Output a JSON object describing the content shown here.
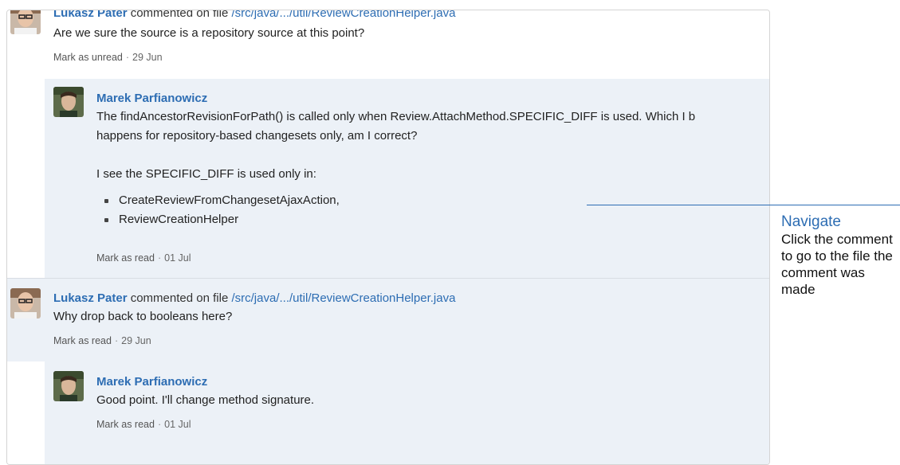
{
  "notifications": [
    {
      "author": "Lukasz Pater",
      "verb": "commented on file",
      "file": "/src/java/.../util/ReviewCreationHelper.java",
      "body": "Are we sure the source is a repository source at this point?",
      "action": "Mark as unread",
      "date": "29 Jun"
    },
    {
      "author": "Marek Parfianowicz",
      "body_lines": [
        "The findAncestorRevisionForPath() is called only when Review.AttachMethod.SPECIFIC_DIFF is used. Which I b",
        "happens for repository-based changesets only, am I correct?"
      ],
      "body_second": "I see the SPECIFIC_DIFF is used only in:",
      "list_items": [
        "CreateReviewFromChangesetAjaxAction,",
        "ReviewCreationHelper"
      ],
      "action": "Mark as read",
      "date": "01 Jul"
    },
    {
      "author": "Lukasz Pater",
      "verb": "commented on file",
      "file": "/src/java/.../util/ReviewCreationHelper.java",
      "body": "Why drop back to booleans here?",
      "action": "Mark as read",
      "date": "29 Jun"
    },
    {
      "author": "Marek Parfianowicz",
      "body": "Good point. I'll change method signature.",
      "action": "Mark as read",
      "date": "01 Jul"
    }
  ],
  "separator": "·",
  "callout": {
    "title": "Navigate",
    "text": "Click the comment to go to the file the comment was made"
  },
  "colors": {
    "link": "#2d6db3",
    "read_background": "#ecf1f7",
    "unread_background": "#ffffff"
  }
}
